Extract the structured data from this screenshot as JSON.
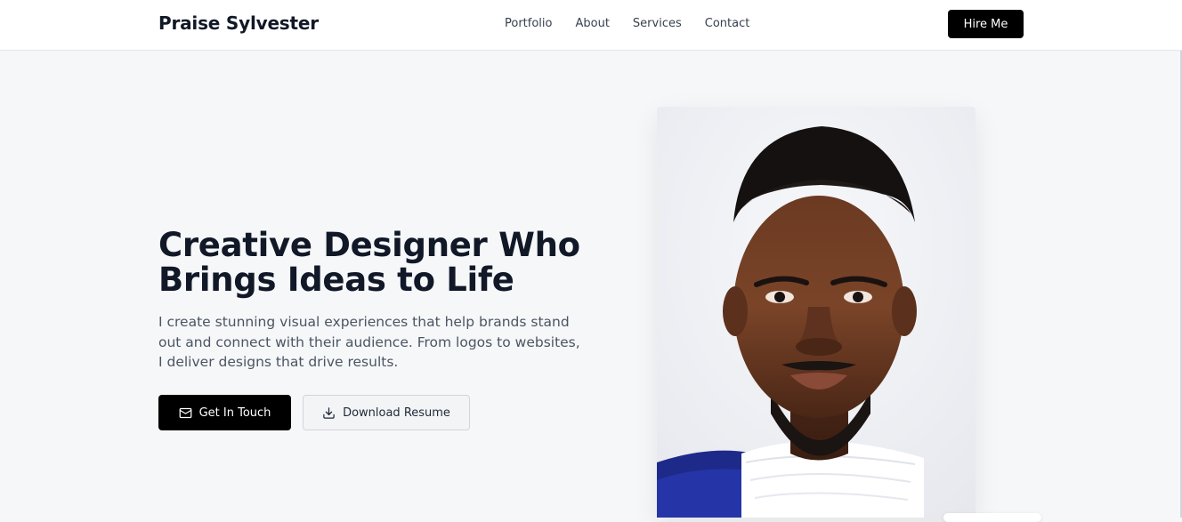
{
  "brand": {
    "name": "Praise Sylvester"
  },
  "nav": {
    "links": [
      "Portfolio",
      "About",
      "Services",
      "Contact"
    ],
    "cta_label": "Hire Me"
  },
  "hero": {
    "title_line1": "Creative Designer Who",
    "title_line2": "Brings Ideas to Life",
    "subtitle": "I create stunning visual experiences that help brands stand out and connect with their audience. From logos to websites, I deliver designs that drive results.",
    "primary_button": {
      "label": "Get In Touch",
      "icon": "mail-icon"
    },
    "secondary_button": {
      "label": "Download Resume",
      "icon": "download-icon"
    }
  },
  "colors": {
    "accent": "#000000",
    "background": "#f6f7f9",
    "text": "#111827"
  }
}
